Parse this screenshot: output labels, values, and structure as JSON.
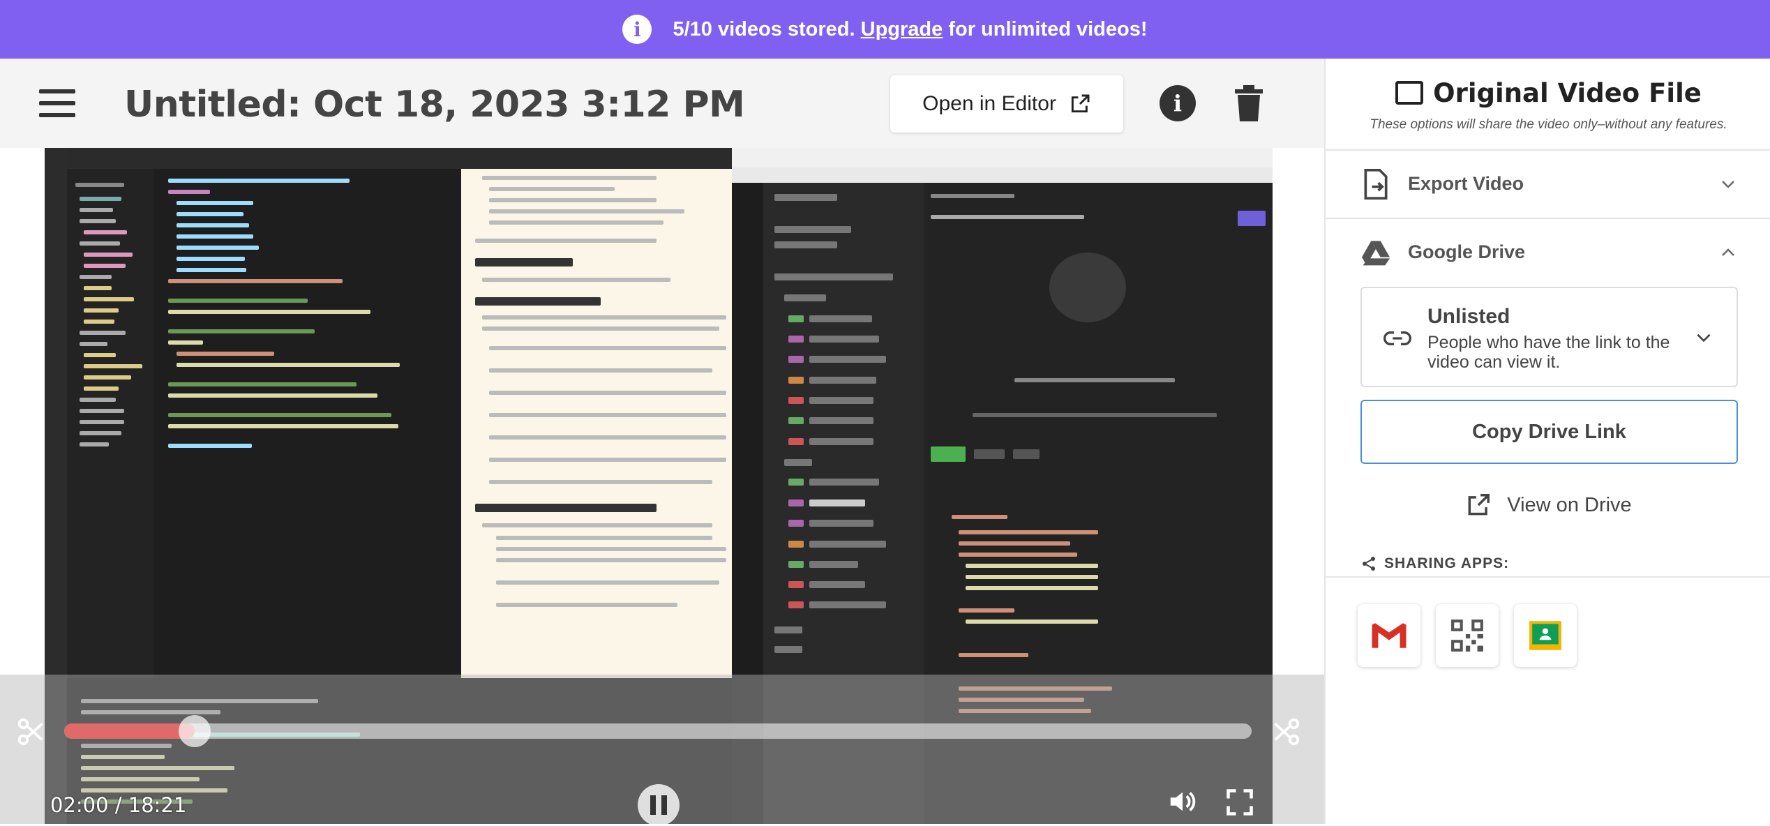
{
  "banner": {
    "prefix": "5/10 videos stored.",
    "link": "Upgrade",
    "suffix": "for unlimited videos!",
    "info_icon": "info-icon",
    "color": "#8060f0"
  },
  "header": {
    "title": "Untitled: Oct 18, 2023 3:12 PM",
    "open_in_editor": "Open in Editor"
  },
  "player": {
    "time": "02:00 / 18:21",
    "progress_fraction": 0.11,
    "accent": "#e06a6a"
  },
  "sidebar": {
    "title": "Original Video File",
    "note": "These options will share the video only–without any features.",
    "export_label": "Export Video",
    "drive_label": "Google Drive",
    "unlisted_title": "Unlisted",
    "unlisted_desc": "People who have the link to the video can view it.",
    "copy_link": "Copy Drive Link",
    "view_on_drive": "View on Drive",
    "sharing_apps": "SHARING APPS:",
    "apps": [
      "gmail-icon",
      "qr-code-icon",
      "google-classroom-icon"
    ],
    "accent_border": "#4a90d9"
  }
}
